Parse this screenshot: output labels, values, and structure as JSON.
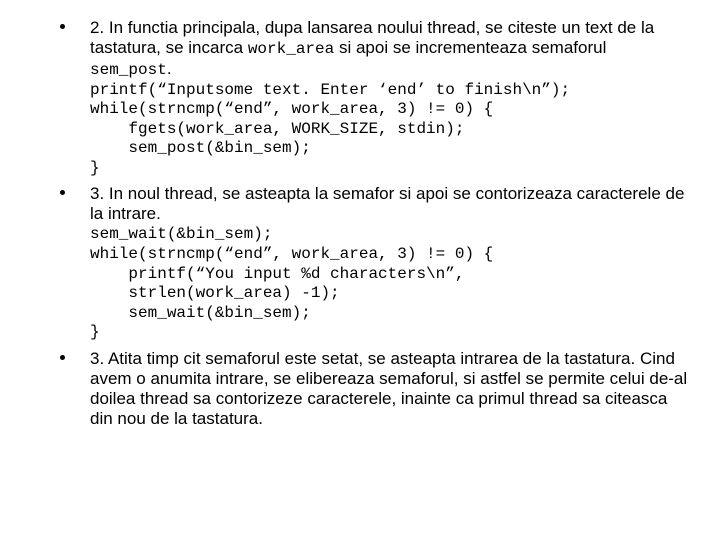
{
  "items": [
    {
      "prose_before": "2. In functia principala, dupa lansarea noului thread, se citeste un text de la tastatura, se incarca ",
      "inline_code_1": "work_area",
      "prose_mid": " si apoi se incrementeaza semaforul ",
      "inline_code_2": "sem_post",
      "prose_after": ".",
      "code": "printf(“Inputsome text. Enter ‘end’ to finish\\n”);\nwhile(strncmp(“end”, work_area, 3) != 0) {\n    fgets(work_area, WORK_SIZE, stdin);\n    sem_post(&bin_sem);\n}"
    },
    {
      "prose": "3. In noul thread, se asteapta la semafor  si apoi se contorizeaza caracterele de la intrare.",
      "code": "sem_wait(&bin_sem);\nwhile(strncmp(“end”, work_area, 3) != 0) {\n    printf(“You input %d characters\\n”,\n    strlen(work_area) -1);\n    sem_wait(&bin_sem);\n}"
    },
    {
      "prose": "3. Atita timp cit semaforul este setat, se asteapta intrarea de la tastatura. Cind avem o anumita intrare, se elibereaza semaforul, si astfel se permite celui de-al doilea thread sa contorizeze caracterele, inainte ca primul thread sa citeasca din nou de la tastatura."
    }
  ]
}
